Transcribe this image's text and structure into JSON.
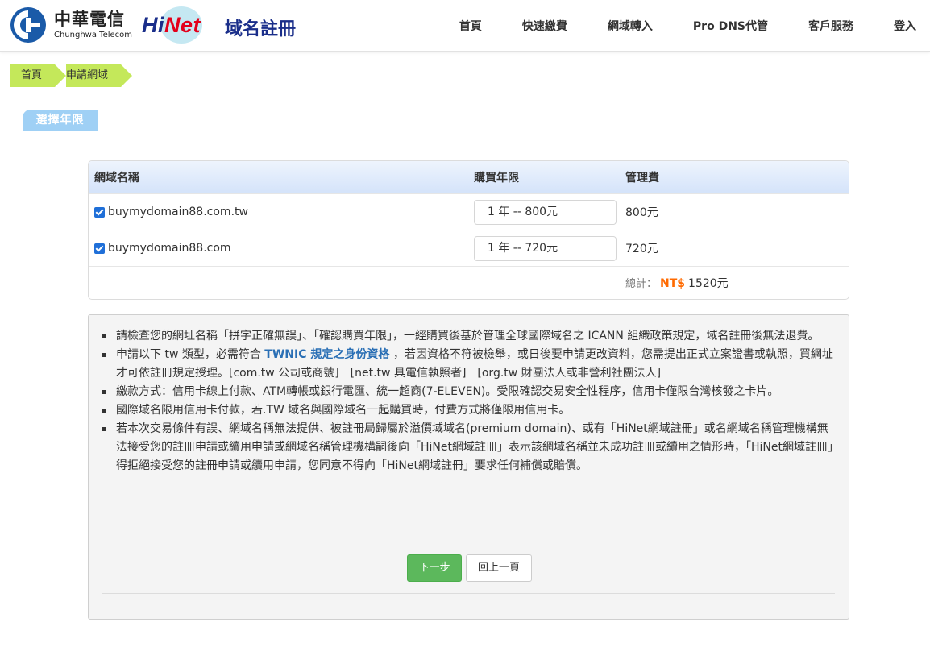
{
  "header": {
    "brand_zh": "中華電信",
    "brand_en": "Chunghwa Telecom",
    "hinet_hi": "Hi",
    "hinet_net": "Net",
    "hinet_title": "域名註冊",
    "nav": [
      "首頁",
      "快速繳費",
      "網域轉入",
      "Pro DNS代管",
      "客戶服務",
      "登入"
    ]
  },
  "breadcrumb": [
    "首頁",
    "申請網域"
  ],
  "section_title": "選擇年限",
  "table": {
    "headers": [
      "網域名稱",
      "購買年限",
      "管理費"
    ],
    "rows": [
      {
        "domain": "buymydomain88.com.tw",
        "years": "1 年 -- 800元",
        "fee": "800元"
      },
      {
        "domain": "buymydomain88.com",
        "years": "1 年 -- 720元",
        "fee": "720元"
      }
    ],
    "total_label": "總計：",
    "total_currency": "NT$",
    "total_amount": "1520元"
  },
  "notice": {
    "item1": "請檢查您的網址名稱「拼字正確無誤」、「確認購買年限」，一經購買後基於管理全球國際域名之 ICANN 組織政策規定，域名註冊後無法退費。",
    "item2_pre": "申請以下 tw 類型，必需符合 ",
    "item2_link": "TWNIC 規定之身份資格",
    "item2_post": " ，若因資格不符被檢舉，或日後要申請更改資料，您需提出正式立案證書或執照，買網址才可依註冊規定授理。[com.tw 公司或商號]　[net.tw 具電信執照者]　[org.tw 財團法人或非營利社團法人]",
    "item3": "繳款方式：信用卡線上付款、ATM轉帳或銀行電匯、統一超商(7-ELEVEN)。受限確認交易安全性程序，信用卡僅限台灣核發之卡片。",
    "item4": "國際域名限用信用卡付款，若.TW 域名與國際域名一起購買時，付費方式將僅限用信用卡。",
    "item5": "若本次交易條件有誤、網域名稱無法提供、被註冊局歸屬於溢價域域名(premium domain)、或有「HiNet網域註冊」或名網域名稱管理機構無法接受您的註冊申請或續用申請或網域名稱管理機構嗣後向「HiNet網域註冊」表示該網域名稱並未成功註冊或續用之情形時，「HiNet網域註冊」得拒絕接受您的註冊申請或續用申請，您同意不得向「HiNet網域註冊」要求任何補償或賠償。"
  },
  "buttons": {
    "next": "下一步",
    "back": "回上一頁"
  },
  "colors": {
    "accent_green": "#5cb85c",
    "breadcrumb": "#c4e85a",
    "section_blue": "#9fd0f5",
    "total_orange": "#ff6a00"
  }
}
